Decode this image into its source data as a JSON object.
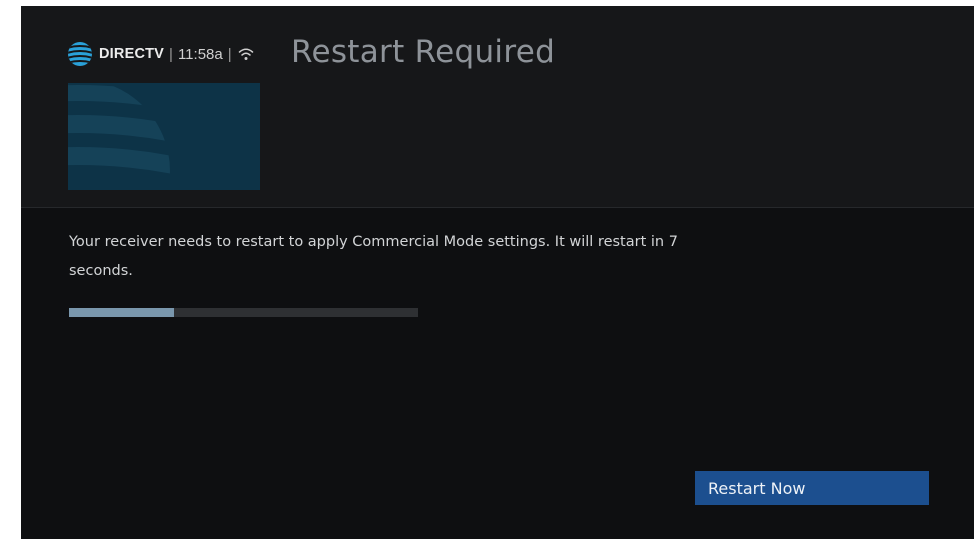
{
  "header": {
    "brand": "DIRECTV",
    "separator": "|",
    "time": "11:58a",
    "brand_icon": "att-globe-icon",
    "network_icon": "wifi-icon"
  },
  "dialog": {
    "title": "Restart Required",
    "message": "Your receiver needs to restart to apply Commercial Mode settings. It will restart in 7 seconds.",
    "progress_percent": 30,
    "restart_button_label": "Restart Now"
  },
  "colors": {
    "background": "#0e0f11",
    "header_background": "#161719",
    "thumbnail": "#0d3347",
    "progress_fill": "#7a97ad",
    "progress_track": "#2e3033",
    "button": "#1c4f8f"
  }
}
